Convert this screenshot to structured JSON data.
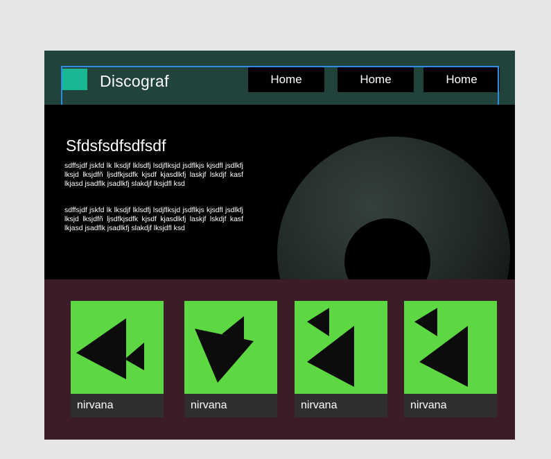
{
  "header": {
    "brand": "Discograf",
    "nav": [
      "Home",
      "Home",
      "Home"
    ],
    "colors": {
      "background": "#22423c",
      "logo": "#19b893",
      "outline": "#2d8ce6"
    }
  },
  "hero": {
    "title": "Sfdsfsdfsdfsdf",
    "paragraphs": [
      "sdffsjdf jskfd lk lksdjf lklsdfj lsdjflksjd jsdflkjs kjsdfl jsdlkfj lksjd lksjdfñ ljsdfkjsdfk kjsdf kjasdlkfj laskjf lskdjf kasf lkjasd jsadflk jsadlkfj slakdjf lksjdfl ksd",
      "sdffsjdf jskfd lk lksdjf lklsdfj lsdjflksjd jsdflkjs kjsdfl jsdlkfj lksjd lksjdfñ ljsdfkjsdfk kjsdf kjasdlkfj laskjf lskdjf kasf lkjasd jsadflk jsadlkfj slakdjf lksjdfl ksd"
    ]
  },
  "albums": {
    "colors": {
      "background": "#3d1c2a",
      "art": "#5dd843",
      "label_bg": "#2f2f2f"
    },
    "items": [
      {
        "label": "nirvana",
        "icon": "album-cover-triangles-icon"
      },
      {
        "label": "nirvana",
        "icon": "album-cover-triangles-icon"
      },
      {
        "label": "nirvana",
        "icon": "album-cover-triangles-icon"
      },
      {
        "label": "nirvana",
        "icon": "album-cover-triangles-icon"
      }
    ]
  }
}
